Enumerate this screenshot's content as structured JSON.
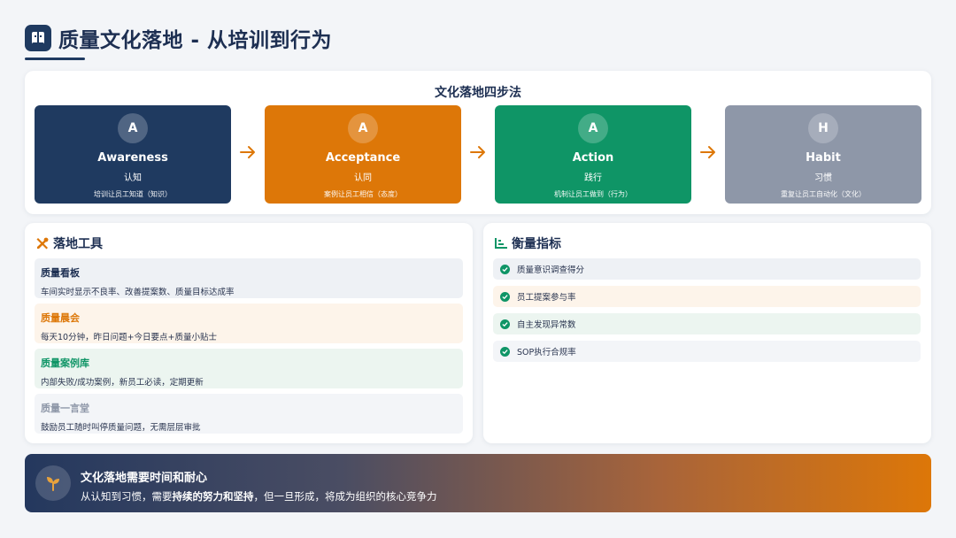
{
  "header": {
    "logo_letter": "",
    "title": "质量文化落地 - 从培训到行为"
  },
  "steps": {
    "title": "文化落地四步法",
    "items": [
      {
        "letter": "A",
        "name": "Awareness",
        "cn": "认知",
        "desc": "培训让员工知道（知识）",
        "color": "#1f3a60"
      },
      {
        "letter": "A",
        "name": "Acceptance",
        "cn": "认同",
        "desc": "案例让员工相信（态度）",
        "color": "#dd7708"
      },
      {
        "letter": "A",
        "name": "Action",
        "cn": "践行",
        "desc": "机制让员工做到（行为）",
        "color": "#0f9566"
      },
      {
        "letter": "H",
        "name": "Habit",
        "cn": "习惯",
        "desc": "重复让员工自动化（文化）",
        "color": "#8e97a8"
      }
    ],
    "arrow_color": "#dd7708"
  },
  "tools": {
    "title": "落地工具",
    "items": [
      {
        "title": "质量看板",
        "desc": "车间实时显示不良率、改善提案数、质量目标达成率",
        "title_color": "#1d2f52",
        "bg": "#eef1f5"
      },
      {
        "title": "质量晨会",
        "desc": "每天10分钟，昨日问题+今日要点+质量小贴士",
        "title_color": "#dd7708",
        "bg": "#fdf4ea"
      },
      {
        "title": "质量案例库",
        "desc": "内部失败/成功案例，新员工必读，定期更新",
        "title_color": "#0f9566",
        "bg": "#ecf5f0"
      },
      {
        "title": "质量一言堂",
        "desc": "鼓励员工随时叫停质量问题，无需层层审批",
        "title_color": "#8e97a8",
        "bg": "#f3f5f8"
      }
    ]
  },
  "metrics": {
    "title": "衡量指标",
    "items": [
      {
        "label": "质量意识调查得分",
        "bg": "#eef1f5"
      },
      {
        "label": "员工提案参与率",
        "bg": "#fdf4ea"
      },
      {
        "label": "自主发现异常数",
        "bg": "#ecf5f0"
      },
      {
        "label": "SOP执行合规率",
        "bg": "#f3f5f8"
      }
    ]
  },
  "banner": {
    "title": "文化落地需要时间和耐心",
    "text_before": "从认知到习惯，需要",
    "text_bold": "持续的努力和坚持",
    "text_after": "，但一旦形成，将成为组织的核心竞争力"
  }
}
